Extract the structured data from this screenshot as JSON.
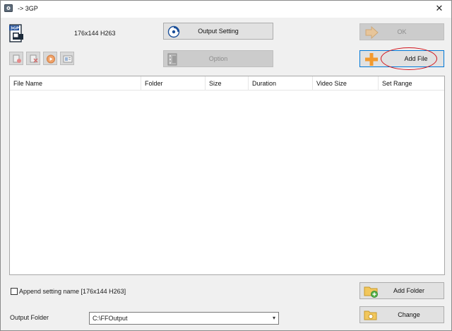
{
  "window": {
    "title": "-> 3GP",
    "close_glyph": "✕"
  },
  "format": {
    "icon_label": "3GP",
    "description": "176x144 H263"
  },
  "buttons": {
    "output_setting": "Output Setting",
    "option": "Option",
    "ok": "OK",
    "add_file": "Add File",
    "add_folder": "Add Folder",
    "change": "Change"
  },
  "toolbar_icons": [
    "remove-file-icon",
    "clear-list-icon",
    "play-icon",
    "media-info-icon"
  ],
  "table": {
    "columns": [
      "File Name",
      "Folder",
      "Size",
      "Duration",
      "Video Size",
      "Set Range"
    ],
    "rows": []
  },
  "append_setting": {
    "label": "Append setting name [176x144 H263]",
    "checked": false
  },
  "output_folder": {
    "label": "Output Folder",
    "value": "C:\\FFOutput"
  },
  "colors": {
    "highlight_ring": "#d2131c",
    "focus_border": "#0078d7",
    "accent_orange": "#f29a2e"
  }
}
